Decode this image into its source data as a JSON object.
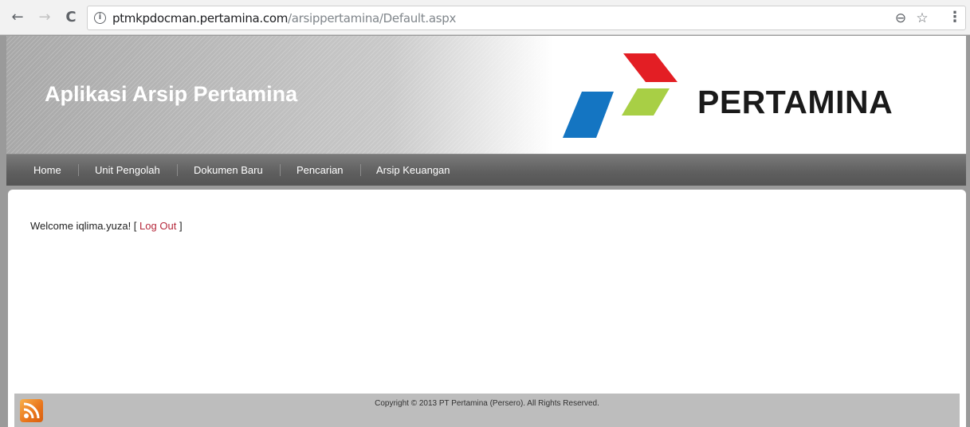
{
  "browser": {
    "back_icon": "←",
    "forward_icon": "→",
    "reload_icon": "C",
    "info_icon": "i",
    "url_host": "ptmkpdocman.pertamina.com",
    "url_path": "/arsippertamina/Default.aspx",
    "zoom_icon": "⊖",
    "star_icon": "☆",
    "menu_icon": "⋮"
  },
  "header": {
    "title": "Aplikasi Arsip Pertamina",
    "brand": "PERTAMINA",
    "logo_colors": {
      "red": "#e31e24",
      "green": "#a8cf45",
      "blue": "#1475c2"
    }
  },
  "menu": {
    "items": [
      {
        "label": "Home"
      },
      {
        "label": "Unit Pengolah"
      },
      {
        "label": "Dokumen Baru"
      },
      {
        "label": "Pencarian"
      },
      {
        "label": "Arsip Keuangan"
      }
    ]
  },
  "main": {
    "welcome_prefix": "Welcome iqlima.yuza! [",
    "logout_label": "Log Out",
    "welcome_suffix": "]"
  },
  "footer": {
    "copyright": "Copyright © 2013 PT Pertamina (Persero). All Rights Reserved.",
    "rss_icon": "rss-icon"
  },
  "colors": {
    "logout_link": "#b5283b",
    "menubar": "#5e5e5e",
    "footer": "#bdbdbd"
  }
}
